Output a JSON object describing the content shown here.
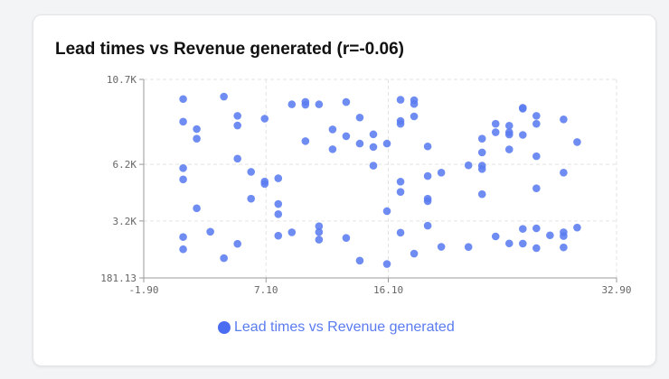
{
  "chart_data": {
    "type": "scatter",
    "title": "Lead times vs Revenue generated (r=-0.06)",
    "xlabel": "",
    "ylabel": "",
    "xlim": [
      -1.9,
      32.9
    ],
    "ylim": [
      181.13,
      10700
    ],
    "x_ticks": [
      "-1.90",
      "7.10",
      "16.10",
      "32.90"
    ],
    "x_tick_values": [
      -1.9,
      7.1,
      16.1,
      32.9
    ],
    "y_ticks": [
      "181.13",
      "3.2K",
      "6.2K",
      "10.7K"
    ],
    "y_tick_values": [
      181.13,
      3200,
      6200,
      10700
    ],
    "grid": true,
    "legend": "bottom",
    "series": [
      {
        "name": "Lead times vs Revenue generated",
        "color": "#5b7cf0",
        "points": [
          [
            1,
            9660
          ],
          [
            1,
            8460
          ],
          [
            1,
            6000
          ],
          [
            1,
            5400
          ],
          [
            1,
            2350
          ],
          [
            1,
            1700
          ],
          [
            2,
            8070
          ],
          [
            2,
            7560
          ],
          [
            2,
            3870
          ],
          [
            3,
            2630
          ],
          [
            4,
            9790
          ],
          [
            4,
            1230
          ],
          [
            5,
            8770
          ],
          [
            5,
            8260
          ],
          [
            5,
            6500
          ],
          [
            5,
            1990
          ],
          [
            6,
            5800
          ],
          [
            6,
            4380
          ],
          [
            7,
            8620
          ],
          [
            7,
            5290
          ],
          [
            7,
            5160
          ],
          [
            8,
            5460
          ],
          [
            8,
            4100
          ],
          [
            8,
            3560
          ],
          [
            8,
            2420
          ],
          [
            9,
            9380
          ],
          [
            9,
            2600
          ],
          [
            10,
            9510
          ],
          [
            10,
            9360
          ],
          [
            10,
            7430
          ],
          [
            11,
            9380
          ],
          [
            11,
            2920
          ],
          [
            11,
            2610
          ],
          [
            11,
            2210
          ],
          [
            12,
            7000
          ],
          [
            12,
            8050
          ],
          [
            13,
            9500
          ],
          [
            13,
            7690
          ],
          [
            13,
            2300
          ],
          [
            14,
            8680
          ],
          [
            14,
            7300
          ],
          [
            14,
            1100
          ],
          [
            15,
            7790
          ],
          [
            15,
            7120
          ],
          [
            15,
            6130
          ],
          [
            16,
            7300
          ],
          [
            16,
            3720
          ],
          [
            16,
            920
          ],
          [
            17,
            9620
          ],
          [
            17,
            8500
          ],
          [
            17,
            8350
          ],
          [
            17,
            5280
          ],
          [
            17,
            4740
          ],
          [
            17,
            2580
          ],
          [
            18,
            9600
          ],
          [
            18,
            9400
          ],
          [
            18,
            8740
          ],
          [
            18,
            1470
          ],
          [
            19,
            7150
          ],
          [
            19,
            5580
          ],
          [
            19,
            4380
          ],
          [
            19,
            4250
          ],
          [
            19,
            2950
          ],
          [
            20,
            5760
          ],
          [
            20,
            1830
          ],
          [
            22,
            6150
          ],
          [
            22,
            1820
          ],
          [
            23,
            6130
          ],
          [
            23,
            5950
          ],
          [
            23,
            4620
          ],
          [
            23,
            7560
          ],
          [
            23,
            6830
          ],
          [
            24,
            8350
          ],
          [
            24,
            7900
          ],
          [
            24,
            2380
          ],
          [
            25,
            7900
          ],
          [
            25,
            7780
          ],
          [
            25,
            8250
          ],
          [
            25,
            6990
          ],
          [
            25,
            2010
          ],
          [
            26,
            9150
          ],
          [
            26,
            9200
          ],
          [
            26,
            7760
          ],
          [
            26,
            2780
          ],
          [
            26,
            2000
          ],
          [
            27,
            8770
          ],
          [
            27,
            8350
          ],
          [
            27,
            6630
          ],
          [
            27,
            4930
          ],
          [
            27,
            2810
          ],
          [
            27,
            1760
          ],
          [
            28,
            2440
          ],
          [
            29,
            8580
          ],
          [
            29,
            5760
          ],
          [
            29,
            2600
          ],
          [
            29,
            2400
          ],
          [
            29,
            1800
          ],
          [
            30,
            7380
          ],
          [
            30,
            2850
          ]
        ]
      }
    ]
  }
}
